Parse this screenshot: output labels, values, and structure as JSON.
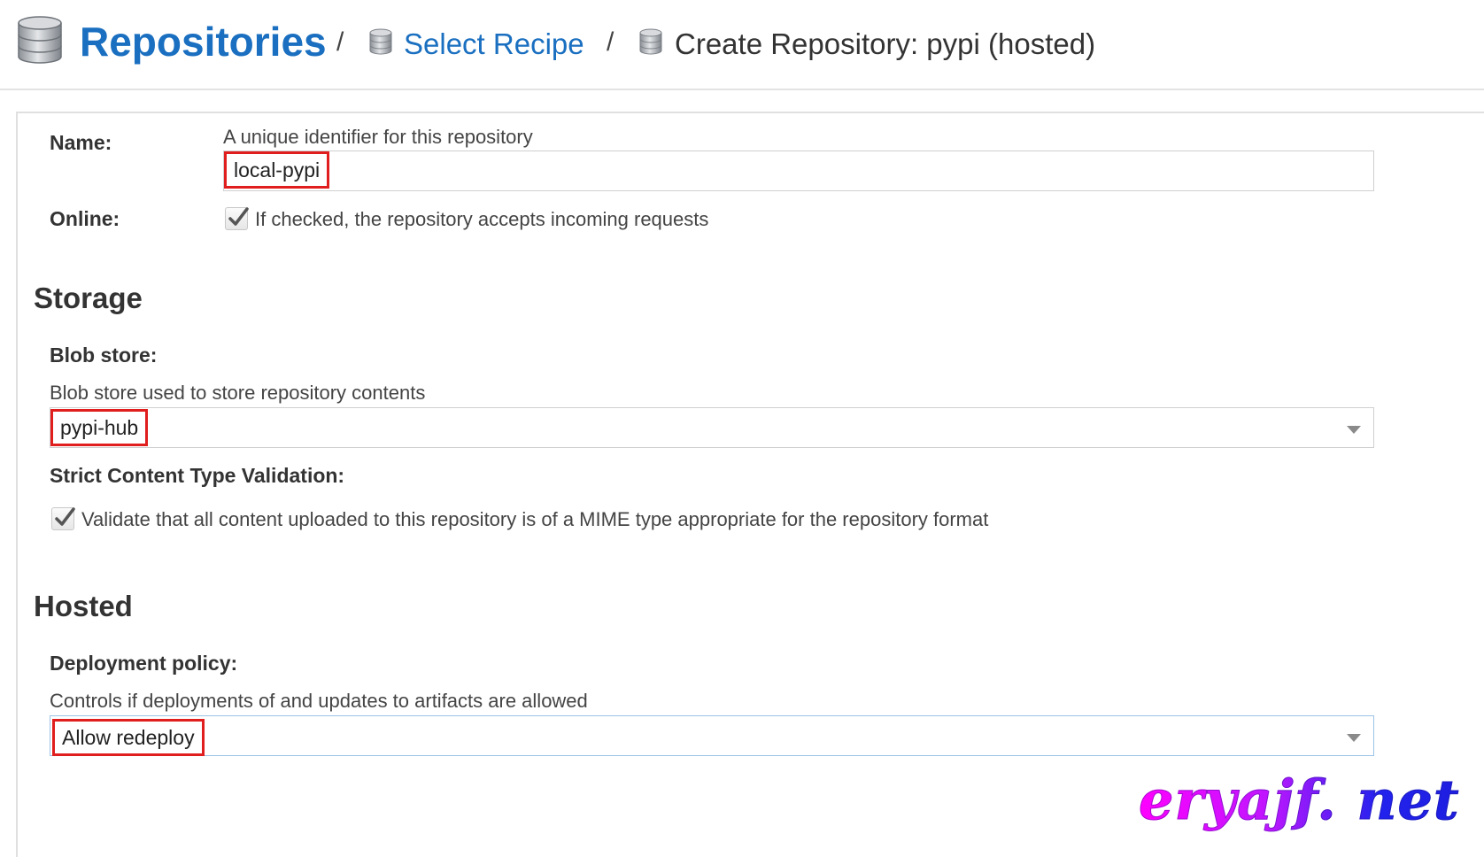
{
  "breadcrumb": {
    "root_label": "Repositories",
    "separator": "/",
    "step2_label": "Select Recipe",
    "current_label": "Create Repository: pypi (hosted)"
  },
  "form": {
    "name": {
      "label": "Name:",
      "help": "A unique identifier for this repository",
      "value": "local-pypi"
    },
    "online": {
      "label": "Online:",
      "checked": true,
      "description": "If checked, the repository accepts incoming requests"
    },
    "storage": {
      "heading": "Storage",
      "blob_store": {
        "label": "Blob store:",
        "help": "Blob store used to store repository contents",
        "value": "pypi-hub"
      },
      "strict_validation": {
        "label": "Strict Content Type Validation:",
        "checked": true,
        "description": "Validate that all content uploaded to this repository is of a MIME type appropriate for the repository format"
      }
    },
    "hosted": {
      "heading": "Hosted",
      "deployment_policy": {
        "label": "Deployment policy:",
        "help": "Controls if deployments of and updates to artifacts are allowed",
        "value": "Allow redeploy"
      }
    }
  },
  "watermark": {
    "text": "eryajf. net",
    "colors": [
      "#ff00ff",
      "#2222ee"
    ]
  },
  "colors": {
    "link_blue": "#1a6fc0",
    "highlight_red": "#e01e1e"
  },
  "icons": {
    "repositories": "database-icon",
    "checkbox_mark": "check-icon",
    "dropdown": "caret-down-icon"
  }
}
